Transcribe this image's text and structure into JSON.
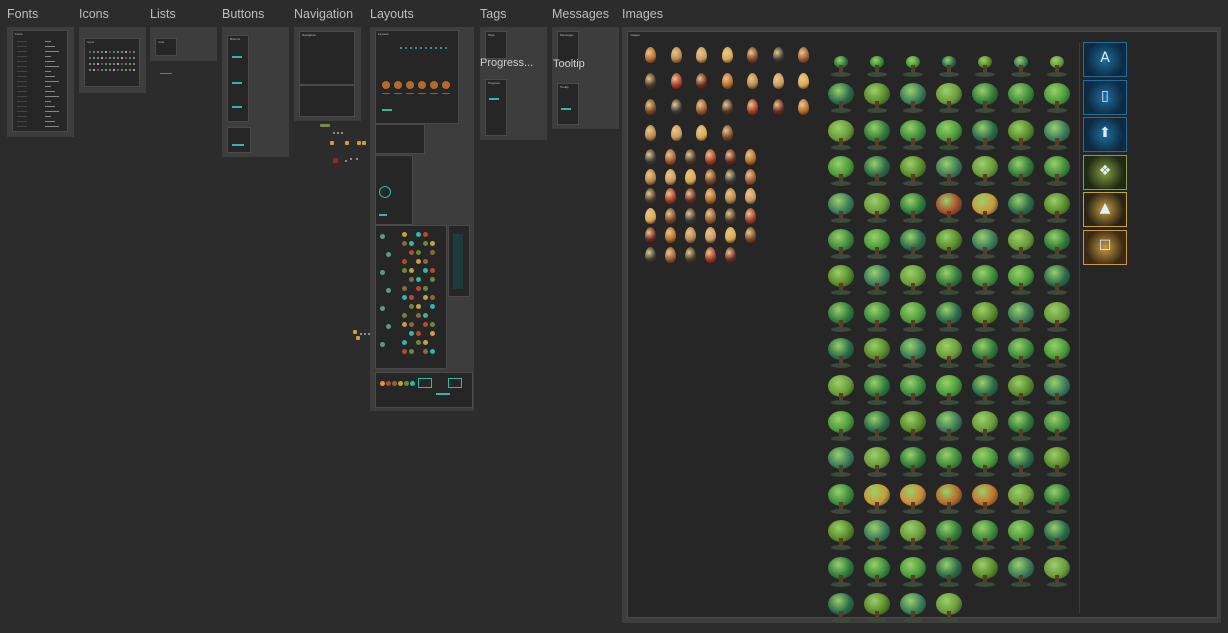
{
  "sections": {
    "fonts": "Fonts",
    "icons": "Icons",
    "lists": "Lists",
    "buttons": "Buttons",
    "navigation": "Navigation",
    "layouts": "Layouts",
    "tags": "Tags",
    "messages": "Messages",
    "images": "Images"
  },
  "frames": {
    "fonts": "Fonts",
    "icons": "Icons",
    "lists": "Lists",
    "buttons": "Buttons",
    "navigation": "Navigation",
    "layouts": "Layouts",
    "tags": "Tags",
    "progress": "Progress",
    "messages": "Messages",
    "tooltip": "Tooltip",
    "images": "Images"
  },
  "floating_labels": {
    "progress": "Progress...",
    "tooltip": "Tooltip"
  },
  "colors": {
    "background": "#2c2c2c",
    "frame": "#3d3d3d",
    "panel": "#262626",
    "accent": "#2fb8a8",
    "rune_frame": "#1e6ea0",
    "rune_gold": "#c8a040"
  }
}
